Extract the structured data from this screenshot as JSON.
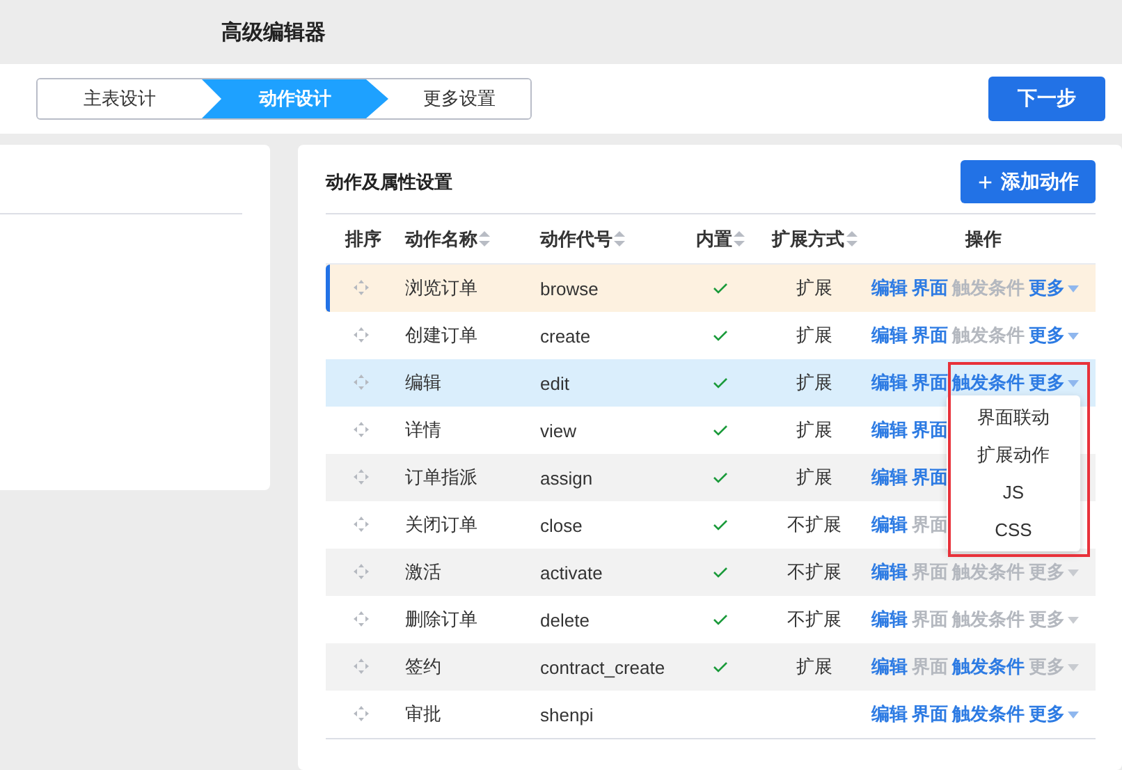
{
  "window": {
    "title": "高级编辑器"
  },
  "steps": [
    {
      "label": "主表设计",
      "selected": false
    },
    {
      "label": "动作设计",
      "selected": true
    },
    {
      "label": "更多设置",
      "selected": false
    }
  ],
  "next_button": "下一步",
  "panel": {
    "title": "动作及属性设置",
    "add_button": {
      "icon": "+",
      "label": "添加动作"
    }
  },
  "table": {
    "columns": [
      {
        "label": "排序",
        "sortable": false
      },
      {
        "label": "动作名称",
        "sortable": true
      },
      {
        "label": "动作代号",
        "sortable": true
      },
      {
        "label": "内置",
        "sortable": true
      },
      {
        "label": "扩展方式",
        "sortable": true
      },
      {
        "label": "操作",
        "sortable": false
      }
    ],
    "rows": [
      {
        "name": "浏览订单",
        "code": "browse",
        "builtin": true,
        "extend": "扩展",
        "highlighted": true,
        "selected": false,
        "actions": [
          {
            "label": "编辑",
            "enabled": true
          },
          {
            "label": "界面",
            "enabled": true
          },
          {
            "label": "触发条件",
            "enabled": false
          },
          {
            "label": "更多",
            "enabled": true,
            "kind": "menu"
          }
        ]
      },
      {
        "name": "创建订单",
        "code": "create",
        "builtin": true,
        "extend": "扩展",
        "highlighted": false,
        "selected": false,
        "actions": [
          {
            "label": "编辑",
            "enabled": true
          },
          {
            "label": "界面",
            "enabled": true
          },
          {
            "label": "触发条件",
            "enabled": false
          },
          {
            "label": "更多",
            "enabled": true,
            "kind": "menu"
          }
        ]
      },
      {
        "name": "编辑",
        "code": "edit",
        "builtin": true,
        "extend": "扩展",
        "highlighted": false,
        "selected": true,
        "actions": [
          {
            "label": "编辑",
            "enabled": true
          },
          {
            "label": "界面",
            "enabled": true
          },
          {
            "label": "触发条件",
            "enabled": true
          },
          {
            "label": "更多",
            "enabled": true,
            "kind": "menu"
          }
        ],
        "menu": {
          "marked": true,
          "items": [
            "界面联动",
            "扩展动作",
            "JS",
            "CSS"
          ]
        }
      },
      {
        "name": "详情",
        "code": "view",
        "builtin": true,
        "extend": "扩展",
        "highlighted": false,
        "selected": false,
        "actions": [
          {
            "label": "编辑",
            "enabled": true
          },
          {
            "label": "界面",
            "enabled": true
          }
        ]
      },
      {
        "name": "订单指派",
        "code": "assign",
        "builtin": true,
        "extend": "扩展",
        "highlighted": false,
        "selected": false,
        "actions": [
          {
            "label": "编辑",
            "enabled": true
          },
          {
            "label": "界面",
            "enabled": true
          }
        ]
      },
      {
        "name": "关闭订单",
        "code": "close",
        "builtin": true,
        "extend": "不扩展",
        "highlighted": false,
        "selected": false,
        "actions": [
          {
            "label": "编辑",
            "enabled": true
          },
          {
            "label": "界面",
            "enabled": false
          }
        ]
      },
      {
        "name": "激活",
        "code": "activate",
        "builtin": true,
        "extend": "不扩展",
        "highlighted": false,
        "selected": false,
        "actions": [
          {
            "label": "编辑",
            "enabled": true
          },
          {
            "label": "界面",
            "enabled": false
          },
          {
            "label": "触发条件",
            "enabled": false
          },
          {
            "label": "更多",
            "enabled": false,
            "kind": "menu"
          }
        ]
      },
      {
        "name": "删除订单",
        "code": "delete",
        "builtin": true,
        "extend": "不扩展",
        "highlighted": false,
        "selected": false,
        "actions": [
          {
            "label": "编辑",
            "enabled": true
          },
          {
            "label": "界面",
            "enabled": false
          },
          {
            "label": "触发条件",
            "enabled": false
          },
          {
            "label": "更多",
            "enabled": false,
            "kind": "menu"
          }
        ]
      },
      {
        "name": "签约",
        "code": "contract_create",
        "builtin": true,
        "extend": "扩展",
        "highlighted": false,
        "selected": false,
        "actions": [
          {
            "label": "编辑",
            "enabled": true
          },
          {
            "label": "界面",
            "enabled": false
          },
          {
            "label": "触发条件",
            "enabled": true
          },
          {
            "label": "更多",
            "enabled": false,
            "kind": "menu"
          }
        ]
      },
      {
        "name": "审批",
        "code": "shenpi",
        "builtin": false,
        "extend": "",
        "highlighted": false,
        "selected": false,
        "actions": [
          {
            "label": "编辑",
            "enabled": true
          },
          {
            "label": "界面",
            "enabled": true
          },
          {
            "label": "触发条件",
            "enabled": true
          },
          {
            "label": "更多",
            "enabled": true,
            "kind": "menu"
          }
        ]
      }
    ]
  }
}
